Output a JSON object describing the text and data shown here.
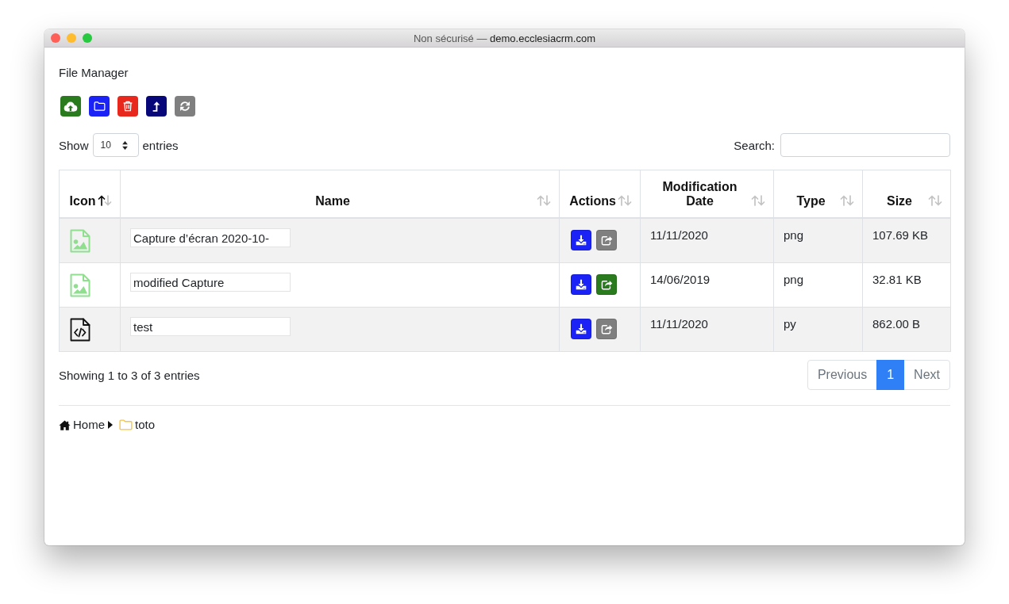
{
  "window": {
    "security_note": "Non sécurisé —",
    "address": "demo.ecclesiacrm.com"
  },
  "page_title": "File Manager",
  "toolbar": [
    {
      "kind": "upload",
      "color": "#2a7a1e"
    },
    {
      "kind": "new-folder",
      "color": "#1a22f5"
    },
    {
      "kind": "delete",
      "color": "#e8281d"
    },
    {
      "kind": "parent-folder",
      "color": "#07077a"
    },
    {
      "kind": "refresh",
      "color": "#7f7f7f"
    }
  ],
  "length_menu": {
    "label": "Show",
    "value": "10",
    "suffix": "entries"
  },
  "search": {
    "label": "Search:"
  },
  "table": {
    "columns": [
      {
        "label": "Icon",
        "sorted_ascending": true
      },
      {
        "label": "Name",
        "sorted_ascending": false
      },
      {
        "label": "Actions",
        "sorted_ascending": false
      },
      {
        "label": "Modification Date",
        "sorted_ascending": false
      },
      {
        "label": "Type",
        "sorted_ascending": false
      },
      {
        "label": "Size",
        "sorted_ascending": false
      }
    ],
    "rows": [
      {
        "kind": "image",
        "name": "Capture d’écran 2020-10-",
        "shared": false,
        "modified": "11/11/2020",
        "type": "png",
        "size": "107.69 KB"
      },
      {
        "kind": "image",
        "name": "modified Capture",
        "shared": true,
        "modified": "14/06/2019",
        "type": "png",
        "size": "32.81 KB"
      },
      {
        "kind": "code",
        "name": "test",
        "shared": false,
        "modified": "11/11/2020",
        "type": "py",
        "size": "862.00 B"
      }
    ]
  },
  "info": "Showing 1 to 3 of 3 entries",
  "pagination": [
    {
      "label": "Previous",
      "selected": false,
      "disabled": true
    },
    {
      "label": "1",
      "selected": true,
      "disabled": false
    },
    {
      "label": "Next",
      "selected": false,
      "disabled": true
    }
  ],
  "breadcrumb": [
    {
      "kind": "home",
      "label": "Home"
    },
    {
      "kind": "folder",
      "label": "toto"
    }
  ]
}
